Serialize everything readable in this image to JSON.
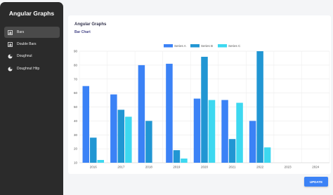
{
  "app": {
    "title": "Angular Graphs"
  },
  "sidebar": {
    "items": [
      {
        "label": "Bars",
        "icon": "bar-chart-icon",
        "active": true
      },
      {
        "label": "Double Bars",
        "icon": "bar-chart-icon",
        "active": false
      },
      {
        "label": "Doughnut",
        "icon": "pie-chart-icon",
        "active": false
      },
      {
        "label": "Doughnut Http",
        "icon": "pie-chart-icon",
        "active": false
      }
    ]
  },
  "panel": {
    "title": "Angular Graphs",
    "subtitle": "Bar Chart"
  },
  "update_button": {
    "label": "UPDATE"
  },
  "colors": {
    "series_a": "#3b82f6",
    "series_b": "#2196d3",
    "series_c": "#3dd8f0",
    "sidebar": "#2b2b2b",
    "accent": "#3b82f6"
  },
  "chart_data": {
    "type": "bar",
    "categories": [
      "2016",
      "2017",
      "2018",
      "2019",
      "2020",
      "2021",
      "2022",
      "2023",
      "2024"
    ],
    "series": [
      {
        "name": "Series A",
        "values": [
          65,
          59,
          80,
          81,
          56,
          55,
          40,
          null,
          null
        ]
      },
      {
        "name": "Series B",
        "values": [
          28,
          48,
          40,
          19,
          86,
          27,
          90,
          null,
          null
        ]
      },
      {
        "name": "Series C",
        "values": [
          12,
          43,
          null,
          13,
          55,
          53,
          21,
          null,
          null
        ]
      }
    ],
    "ylim": [
      10,
      90
    ],
    "yticks": [
      10,
      20,
      30,
      40,
      50,
      60,
      70,
      80,
      90
    ],
    "grid": true,
    "legend": "top-center"
  }
}
